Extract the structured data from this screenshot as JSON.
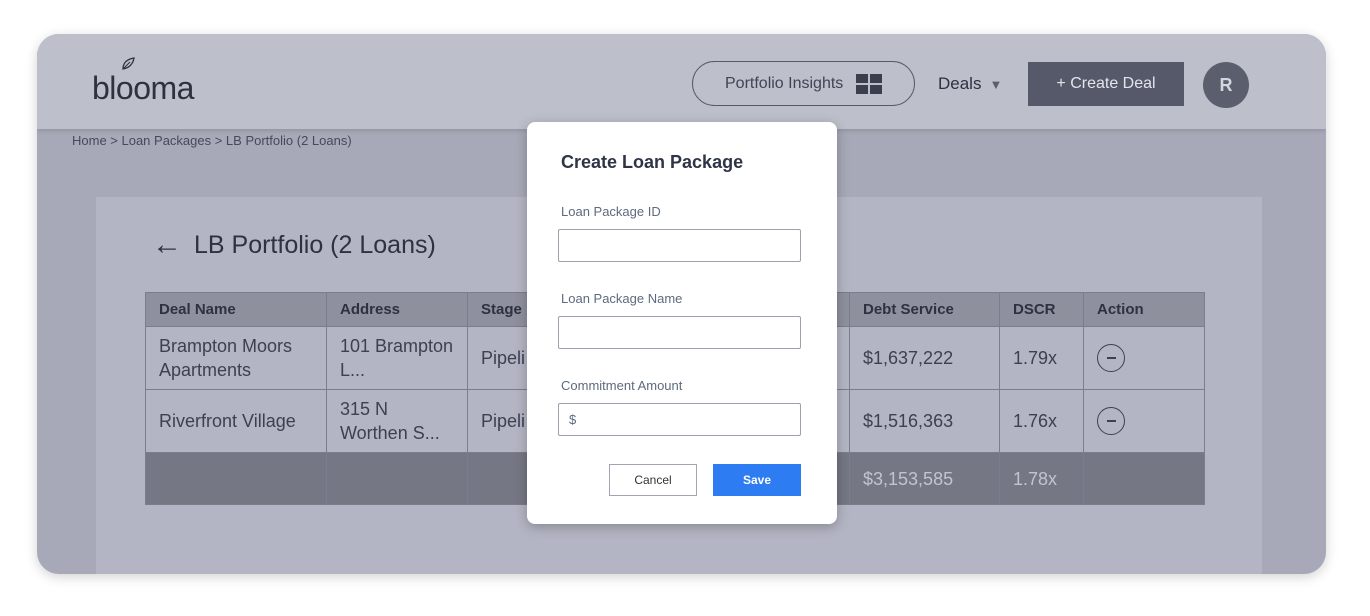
{
  "header": {
    "logo": "blooma",
    "portfolio_insights": "Portfolio Insights",
    "deals": "Deals",
    "create_deal": "+ Create Deal",
    "avatar_initial": "R"
  },
  "breadcrumb": "Home > Loan Packages > LB Portfolio (2 Loans)",
  "page_title": "LB Portfolio (2 Loans)",
  "table": {
    "headers": [
      "Deal Name",
      "Address",
      "Stage",
      "",
      "Debt Service",
      "DSCR",
      "Action"
    ],
    "rows": [
      {
        "deal_name": "Brampton Moors Apartments",
        "address": "101 Brampton L...",
        "stage": "Pipeli",
        "debt_service": "$1,637,222",
        "dscr": "1.79x"
      },
      {
        "deal_name": "Riverfront Village",
        "address": "315 N Worthen S...",
        "stage": "Pipeli",
        "debt_service": "$1,516,363",
        "dscr": "1.76x"
      }
    ],
    "total": {
      "debt_service": "$3,153,585",
      "dscr": "1.78x"
    }
  },
  "modal": {
    "title": "Create Loan Package",
    "id_label": "Loan Package ID",
    "id_value": "",
    "name_label": "Loan Package Name",
    "name_value": "",
    "amount_label": "Commitment Amount",
    "amount_value": "$",
    "cancel": "Cancel",
    "save": "Save"
  },
  "colors": {
    "accent": "#2d7cf2",
    "overlay": "#a7a9b8"
  }
}
